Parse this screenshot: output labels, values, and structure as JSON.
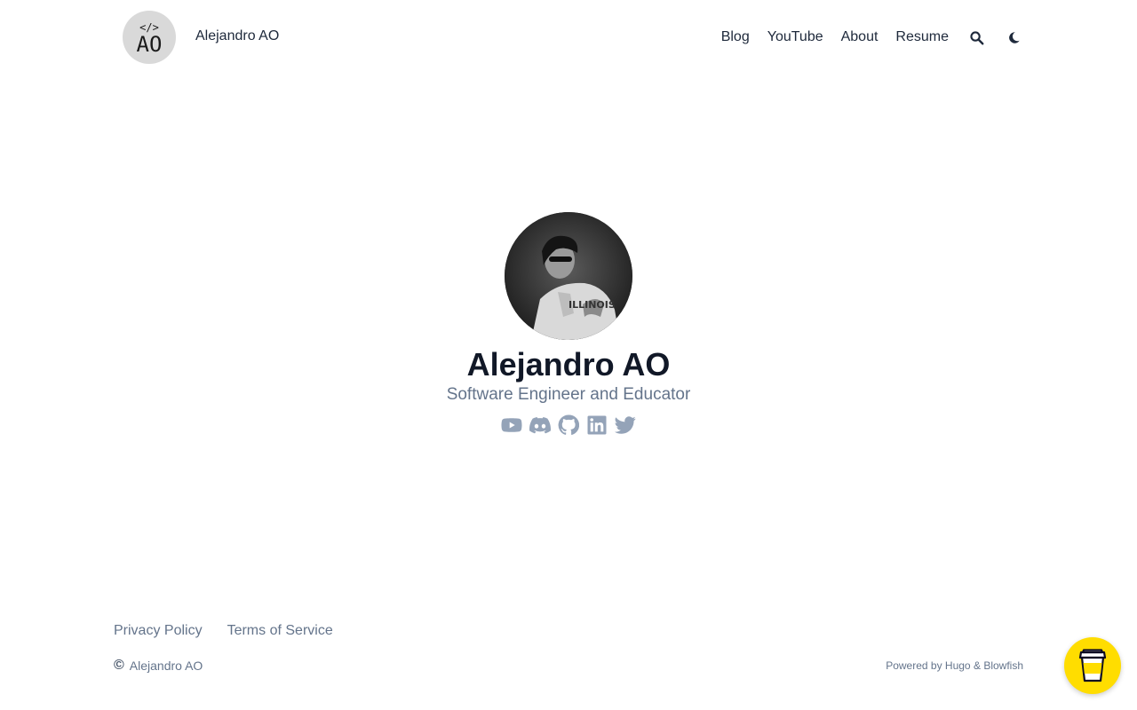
{
  "header": {
    "logo_code": "</>",
    "logo_initials": "AO",
    "site_title": "Alejandro AO",
    "nav": [
      {
        "label": "Blog"
      },
      {
        "label": "YouTube"
      },
      {
        "label": "About"
      },
      {
        "label": "Resume"
      }
    ],
    "search_icon": "search-icon",
    "theme_icon": "moon-icon"
  },
  "hero": {
    "name": "Alejandro AO",
    "tagline": "Software Engineer and Educator",
    "socials": [
      "youtube-icon",
      "discord-icon",
      "github-icon",
      "linkedin-icon",
      "twitter-icon"
    ]
  },
  "footer": {
    "links": [
      {
        "label": "Privacy Policy"
      },
      {
        "label": "Terms of Service"
      }
    ],
    "copyright_symbol": "©",
    "copyright_name": "Alejandro AO",
    "powered_prefix": "Powered by",
    "powered_hugo": "Hugo",
    "powered_amp": "&",
    "powered_blowfish": "Blowfish"
  },
  "colors": {
    "text_primary": "#1e293b",
    "text_muted": "#64748b",
    "social_icon": "#94a3b8",
    "bmc_yellow": "#ffdd00"
  }
}
